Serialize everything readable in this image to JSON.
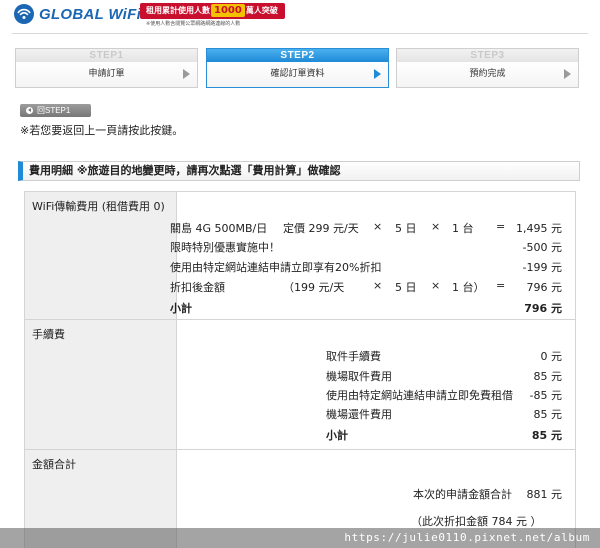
{
  "header": {
    "logo_text": "GLOBAL WiFi",
    "promo_line_pre": "租用累計使用人數",
    "promo_big": "1000",
    "promo_line_post": "萬人突破",
    "promo_sub": "※使用人數含閱覽公眾網路網路連線的人數"
  },
  "steps": [
    {
      "num": "STEP1",
      "label": "申請訂單",
      "active": false
    },
    {
      "num": "STEP2",
      "label": "確認訂單資料",
      "active": true
    },
    {
      "num": "STEP3",
      "label": "預約完成",
      "active": false
    }
  ],
  "back": {
    "button_label": "回STEP1",
    "note": "※若您要返回上一頁請按此按鍵。"
  },
  "section_title": "費用明細 ※旅遊目的地變更時，請再次點選「費用計算」做確認",
  "wifi": {
    "label": "WiFi傳輸費用 (租借費用 0)",
    "plan": "關島 4G 500MB/日",
    "plan_rate": "定價 299 元/天",
    "times1": "×",
    "days": "5 日",
    "times2": "×",
    "units": "1 台",
    "equals": "=",
    "plan_amount": "1,495 元",
    "promo_text": "限時特別優惠實施中！",
    "promo_amount": "-500 元",
    "discount_text": "使用由特定網站連結申請立即享有20%折扣",
    "discount_amount": "-199 元",
    "after_label": "折扣後金額",
    "after_rate": "（199 元/天",
    "after_times1": "×",
    "after_days": "5 日",
    "after_times2": "×",
    "after_units": "1 台）",
    "after_equals": "=",
    "after_amount": "796 元",
    "subtotal_label": "小計",
    "subtotal_amount": "796 元"
  },
  "fees": {
    "label": "手續費",
    "rows": [
      {
        "text": "取件手續費",
        "amount": "0 元"
      },
      {
        "text": "機場取件費用",
        "amount": "85 元"
      },
      {
        "text": "使用由特定網站連結申請立即免費租借",
        "amount": "-85 元"
      },
      {
        "text": "機場還件費用",
        "amount": "85 元"
      }
    ],
    "subtotal_label": "小計",
    "subtotal_amount": "85 元"
  },
  "total": {
    "label": "金額合計",
    "text": "本次的申請金額合計",
    "amount": "881 元",
    "discount_note": "（此次折扣金額 784 元 ）"
  },
  "watermark_url": "https://julie0110.pixnet.net/album"
}
